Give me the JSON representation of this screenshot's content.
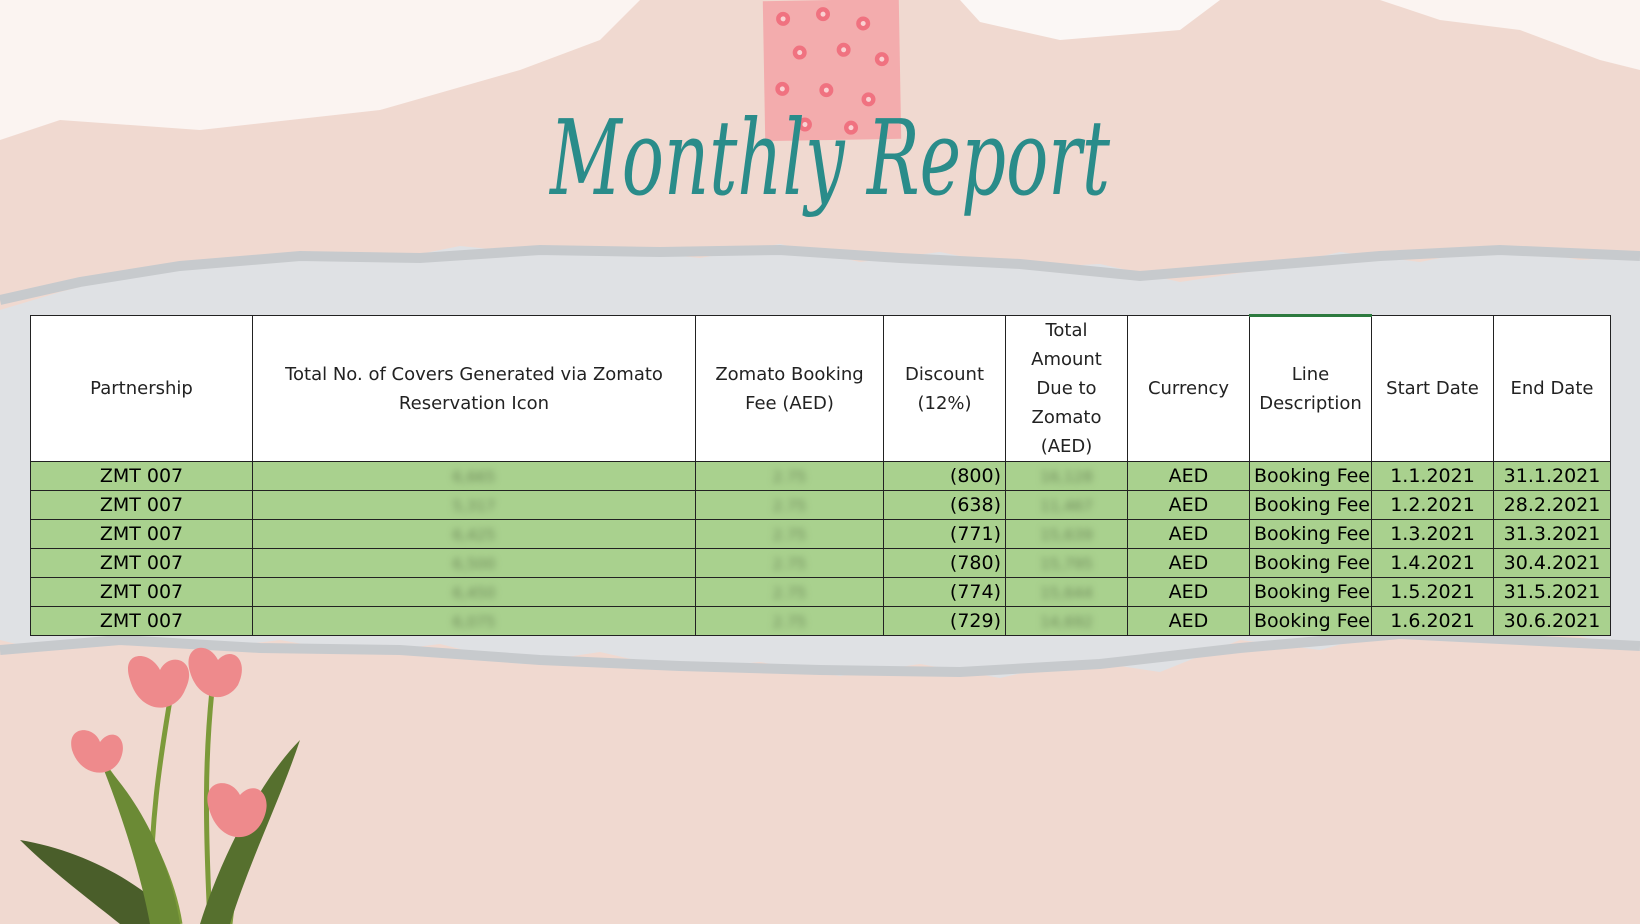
{
  "title": "Monthly Report",
  "colors": {
    "background": "#f0d9d0",
    "title": "#2a8c8a",
    "row_fill": "#a9d18e",
    "tape": "#f4a9ab"
  },
  "table": {
    "headers": [
      "Partnership",
      "Total No. of Covers Generated via Zomato Reservation Icon",
      "Zomato Booking Fee (AED)",
      "Discount (12%)",
      "Total Amount Due to Zomato (AED)",
      "Currency",
      "Line Description",
      "Start Date",
      "End Date"
    ],
    "rows": [
      {
        "partnership": "ZMT 007",
        "covers": "6,665",
        "fee": "2.75",
        "discount": "(800)",
        "total": "16,128",
        "currency": "AED",
        "line": "Booking Fee",
        "start": "1.1.2021",
        "end": "31.1.2021"
      },
      {
        "partnership": "ZMT 007",
        "covers": "5,317",
        "fee": "2.75",
        "discount": "(638)",
        "total": "11,467",
        "currency": "AED",
        "line": "Booking Fee",
        "start": "1.2.2021",
        "end": "28.2.2021"
      },
      {
        "partnership": "ZMT 007",
        "covers": "6,425",
        "fee": "2.75",
        "discount": "(771)",
        "total": "15,639",
        "currency": "AED",
        "line": "Booking Fee",
        "start": "1.3.2021",
        "end": "31.3.2021"
      },
      {
        "partnership": "ZMT 007",
        "covers": "6,500",
        "fee": "2.75",
        "discount": "(780)",
        "total": "15,795",
        "currency": "AED",
        "line": "Booking Fee",
        "start": "1.4.2021",
        "end": "30.4.2021"
      },
      {
        "partnership": "ZMT 007",
        "covers": "6,450",
        "fee": "2.75",
        "discount": "(774)",
        "total": "15,644",
        "currency": "AED",
        "line": "Booking Fee",
        "start": "1.5.2021",
        "end": "31.5.2021"
      },
      {
        "partnership": "ZMT 007",
        "covers": "6,075",
        "fee": "2.75",
        "discount": "(729)",
        "total": "14,692",
        "currency": "AED",
        "line": "Booking Fee",
        "start": "1.6.2021",
        "end": "30.6.2021"
      }
    ]
  }
}
